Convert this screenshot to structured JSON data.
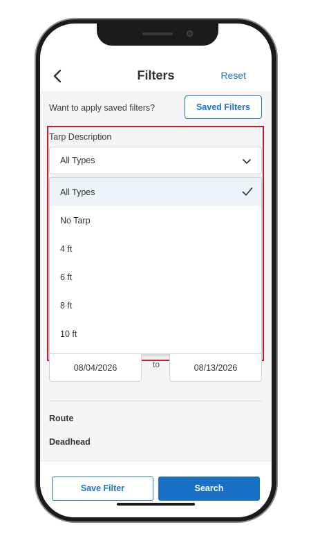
{
  "header": {
    "title": "Filters",
    "reset_label": "Reset",
    "back_icon": "chevron-left-icon"
  },
  "saved_filters": {
    "prompt": "Want to apply saved filters?",
    "button_label": "Saved Filters"
  },
  "tarp_description": {
    "label": "Tarp Description",
    "selected_value": "All Types",
    "options": [
      {
        "label": "All Types",
        "selected": true
      },
      {
        "label": "No Tarp",
        "selected": false
      },
      {
        "label": "4 ft",
        "selected": false
      },
      {
        "label": "6 ft",
        "selected": false
      },
      {
        "label": "8 ft",
        "selected": false
      },
      {
        "label": "10 ft",
        "selected": false
      }
    ]
  },
  "date_range": {
    "start": "08/04/2026",
    "separator": "to",
    "end": "08/13/2026"
  },
  "sections": {
    "route_label": "Route",
    "deadhead_label": "Deadhead"
  },
  "footer": {
    "save_filter_label": "Save Filter",
    "search_label": "Search"
  },
  "colors": {
    "accent": "#1a75c9",
    "highlight_border": "#c8182a",
    "selected_option_bg": "#eef3f9"
  }
}
